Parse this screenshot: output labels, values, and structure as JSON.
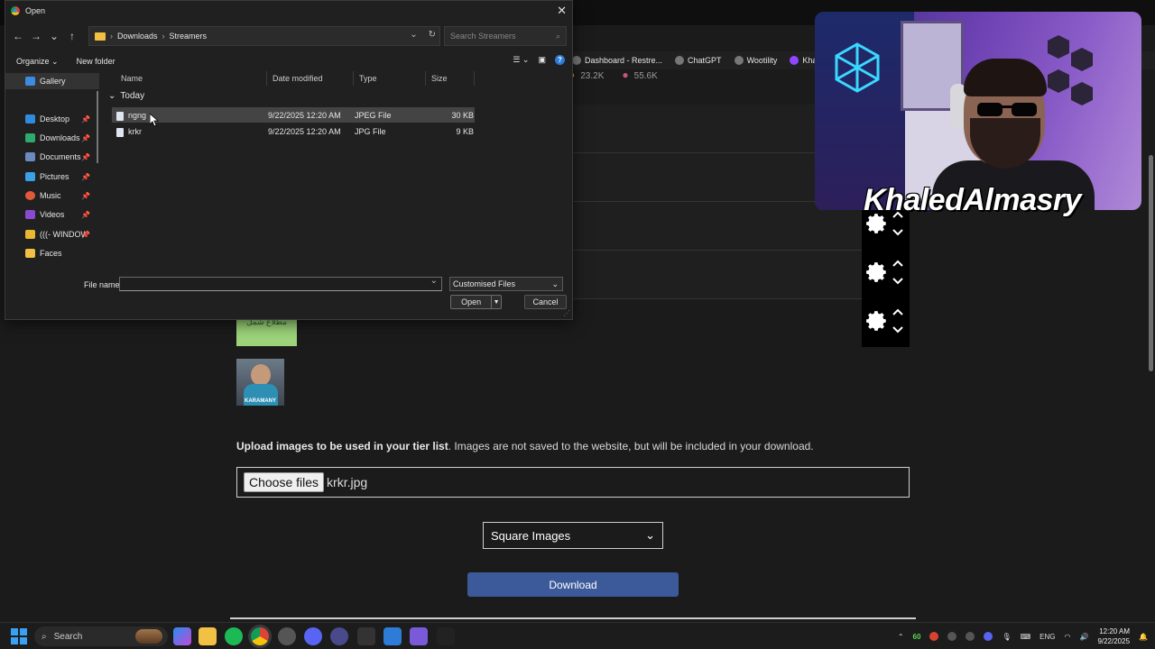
{
  "browser": {
    "bookmarks": [
      {
        "label": "Dashboard - Restre...",
        "icon": "restream-icon"
      },
      {
        "label": "ChatGPT",
        "icon": "chatgpt-icon"
      },
      {
        "label": "Wootility",
        "icon": "wootility-icon"
      },
      {
        "label": "KhaledAlma...",
        "icon": "twitch-icon"
      }
    ],
    "stats": [
      "23.2K",
      "55.6K"
    ]
  },
  "page": {
    "tile_green_text": "مطلاع شمل",
    "tile_avatar_text": "KARAMANY",
    "upload_bold": "Upload images to be used in your tier list",
    "upload_rest": ". Images are not saved to the website, but will be included in your download.",
    "choose_files_label": "Choose files",
    "chosen_file": "krkr.jpg",
    "shape_select": "Square Images",
    "download_label": "Download"
  },
  "overlay": {
    "streamer_name": "KhaledAlmasry"
  },
  "dialog": {
    "title": "Open",
    "breadcrumb": [
      "Downloads",
      "Streamers"
    ],
    "search_placeholder": "Search Streamers",
    "organize_label": "Organize",
    "new_folder_label": "New folder",
    "nav_items": [
      {
        "label": "Gallery",
        "icon": "gallery-icon",
        "color": "#3d8be0"
      },
      {
        "label": "Desktop",
        "icon": "desktop-icon",
        "color": "#2f8be0"
      },
      {
        "label": "Downloads",
        "icon": "downloads-icon",
        "color": "#2eaa6e"
      },
      {
        "label": "Documents",
        "icon": "documents-icon",
        "color": "#6b8bbf"
      },
      {
        "label": "Pictures",
        "icon": "pictures-icon",
        "color": "#3aa0e8"
      },
      {
        "label": "Music",
        "icon": "music-icon",
        "color": "#e05a3a"
      },
      {
        "label": "Videos",
        "icon": "videos-icon",
        "color": "#8a4ad0"
      },
      {
        "label": "(((- WINDOW",
        "icon": "lock-icon",
        "color": "#e8b830"
      },
      {
        "label": "Faces",
        "icon": "folder-icon",
        "color": "#f2c043"
      }
    ],
    "columns": [
      "Name",
      "Date modified",
      "Type",
      "Size"
    ],
    "group": "Today",
    "files": [
      {
        "name": "ngng",
        "date": "9/22/2025 12:20 AM",
        "type": "JPEG File",
        "size": "30 KB"
      },
      {
        "name": "krkr",
        "date": "9/22/2025 12:20 AM",
        "type": "JPG File",
        "size": "9 KB"
      }
    ],
    "file_name_label": "File name:",
    "file_name_value": "",
    "filter": "Customised Files",
    "open_label": "Open",
    "cancel_label": "Cancel"
  },
  "taskbar": {
    "search_label": "Search",
    "fps": "60",
    "lang": "ENG",
    "time": "12:20 AM",
    "date": "9/22/2025"
  }
}
